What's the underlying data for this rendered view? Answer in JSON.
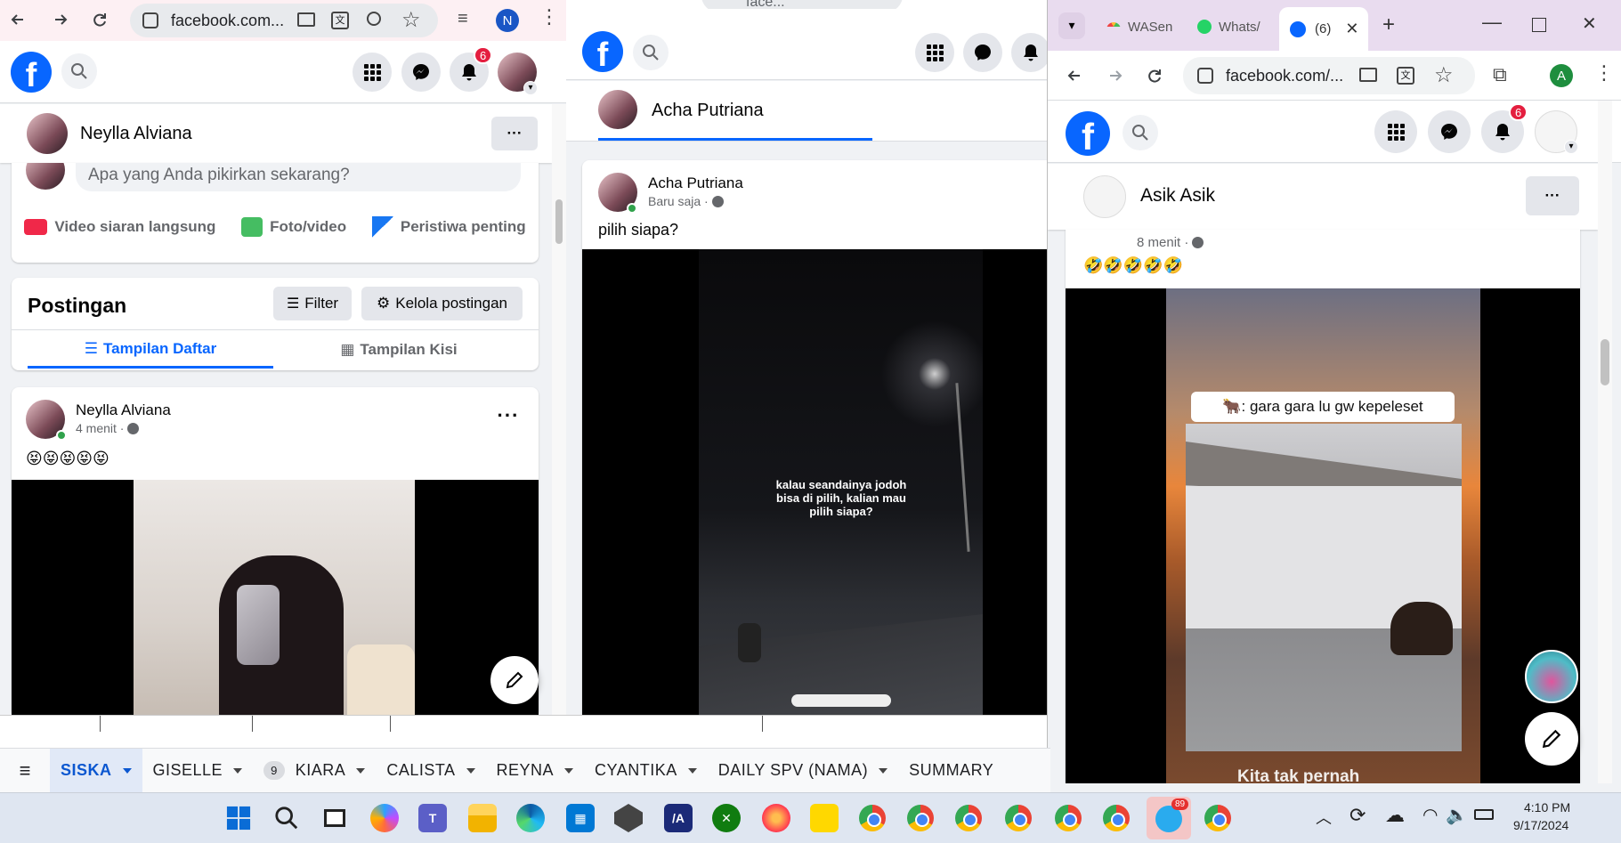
{
  "window_left": {
    "address": "facebook.com...",
    "profile_initial": "N",
    "notifications_count": "6",
    "profile_name": "Neylla Alviana",
    "composer_placeholder": "Apa yang Anda pikirkan sekarang?",
    "composer_actions": [
      "Video siaran langsung",
      "Foto/video",
      "Peristiwa penting"
    ],
    "posts_title": "Postingan",
    "filter_label": "Filter",
    "manage_label": "Kelola postingan",
    "view_tabs": [
      "Tampilan Daftar",
      "Tampilan Kisi"
    ],
    "post": {
      "author": "Neylla Alviana",
      "time": "4 menit ·",
      "text": "😝😝😝😝😝"
    }
  },
  "window_middle": {
    "address": "face...",
    "profile_name": "Acha Putriana",
    "post": {
      "author": "Acha Putriana",
      "time": "Baru saja ·",
      "text": "pilih siapa?"
    },
    "video_caption": "kalau seandainya jodoh bisa di pilih, kalian mau pilih siapa?"
  },
  "window_right": {
    "tabs": [
      {
        "label": "WASen"
      },
      {
        "label": "Whats/"
      },
      {
        "label": "(6)"
      }
    ],
    "address": "facebook.com/...",
    "profile_initial": "A",
    "notifications_count": "6",
    "profile_name": "Asik Asik",
    "post": {
      "time": "8 menit ·",
      "text": "🤣🤣🤣🤣🤣"
    },
    "video_caption": "🐂: gara gara lu gw kepeleset",
    "video_subtitle": "Kita tak pernah"
  },
  "sheet_tabs": [
    {
      "label": "SISKA",
      "active": true
    },
    {
      "label": "GISELLE"
    },
    {
      "label": "KIARA",
      "badge": "9"
    },
    {
      "label": "CALISTA"
    },
    {
      "label": "REYNA"
    },
    {
      "label": "CYANTIKA"
    },
    {
      "label": "DAILY SPV (NAMA)"
    },
    {
      "label": "SUMMARY"
    }
  ],
  "taskbar": {
    "time": "4:10 PM",
    "date": "9/17/2024",
    "telegram_badge": "89"
  },
  "colors": {
    "facebook_blue": "#0866ff",
    "badge_red": "#e41e3f"
  }
}
